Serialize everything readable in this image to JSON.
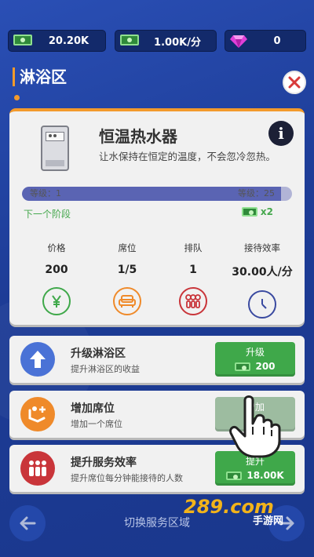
{
  "currencies": [
    {
      "icon": "cash-icon",
      "value": "20.20K"
    },
    {
      "icon": "cash-icon",
      "value": "1.00K/分"
    },
    {
      "icon": "gem-icon",
      "value": "0"
    }
  ],
  "section": {
    "title": "淋浴区"
  },
  "facility": {
    "name": "恒温热水器",
    "description": "让水保持在恒定的温度，不会忽冷忽热。",
    "level_label_left": "等级：1",
    "level_label_right": "等级：25",
    "level_current": 1,
    "level_max": 25,
    "next_stage": "下一个阶段",
    "multiplier": "x2"
  },
  "stats": [
    {
      "label": "价格",
      "value": "200",
      "icon": "yen-icon",
      "color": "#3fa84a"
    },
    {
      "label": "席位",
      "value": "1/5",
      "icon": "sofa-icon",
      "color": "#ef8a2a"
    },
    {
      "label": "排队",
      "value": "1",
      "icon": "people-icon",
      "color": "#c9353a"
    },
    {
      "label": "接待效率",
      "value": "30.00人/分",
      "icon": "clock-icon",
      "color": "#3a4aa0"
    }
  ],
  "upgrades": [
    {
      "title": "升级淋浴区",
      "desc": "提升淋浴区的收益",
      "button": "升级",
      "cost": "200",
      "icon": "arrow-up-icon",
      "icon_color": "#4a72d6"
    },
    {
      "title": "增加席位",
      "desc": "增加一个席位",
      "button": "增加",
      "cost": "",
      "icon": "seat-add-icon",
      "icon_color": "#ef8a2a"
    },
    {
      "title": "提升服务效率",
      "desc": "提升席位每分钟能接待的人数",
      "button": "提升",
      "cost": "18.00K",
      "icon": "staff-icon",
      "icon_color": "#c9353a"
    }
  ],
  "nav": {
    "label": "切换服务区域"
  },
  "watermark": {
    "text": "289.com",
    "subtext": "手游网"
  }
}
